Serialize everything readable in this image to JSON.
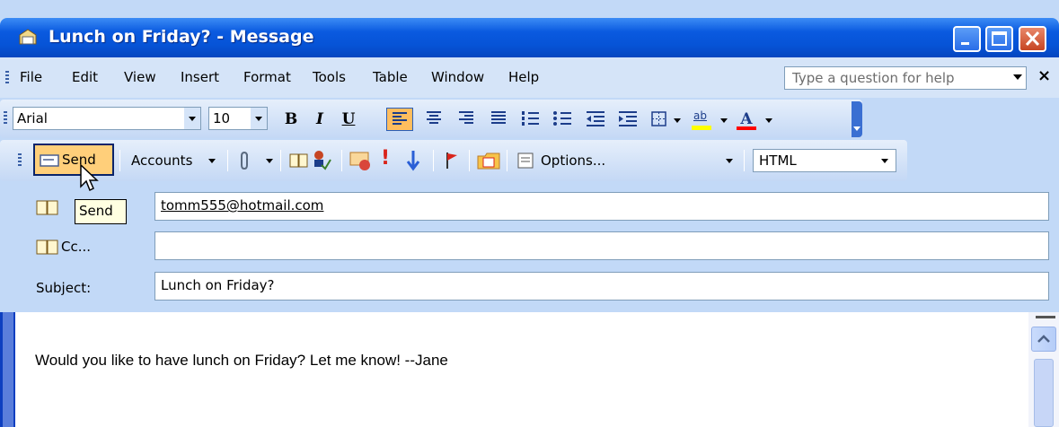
{
  "window": {
    "title": "Lunch on Friday? - Message"
  },
  "menu": {
    "items": [
      {
        "label": "File"
      },
      {
        "label": "Edit"
      },
      {
        "label": "View"
      },
      {
        "label": "Insert"
      },
      {
        "label": "Format"
      },
      {
        "label": "Tools"
      },
      {
        "label": "Table"
      },
      {
        "label": "Window"
      },
      {
        "label": "Help"
      }
    ],
    "help_placeholder": "Type a question for help",
    "close_glyph": "×"
  },
  "format_toolbar": {
    "font": "Arial",
    "size": "10",
    "bold": "B",
    "italic": "I",
    "underline": "U",
    "font_color_letter": "A",
    "highlight_label": "ab"
  },
  "standard_toolbar": {
    "send": "Send",
    "accounts": "Accounts",
    "options": "Options...",
    "format": "HTML"
  },
  "fields": {
    "to_value": "tomm555@hotmail.com",
    "cc_label": "Cc...",
    "cc_value": "",
    "subject_label": "Subject:",
    "subject_value": "Lunch on Friday?"
  },
  "tooltip": "Send",
  "message": {
    "body": "Would you like to have lunch on Friday? Let me know! --Jane"
  },
  "colors": {
    "titlebar": "#0653d6",
    "toolbar": "#c4d8f5",
    "active_button": "#ffbd5e"
  }
}
